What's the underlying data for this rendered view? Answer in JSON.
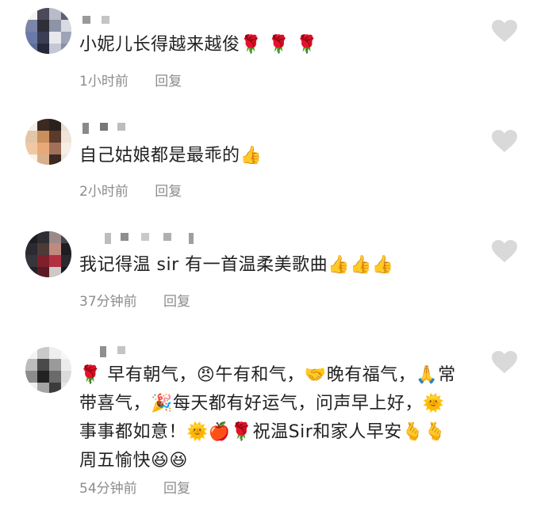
{
  "comments": [
    {
      "text": "小妮儿长得越来越俊🌹 🌹 🌹",
      "time": "1小时前",
      "reply": "回复"
    },
    {
      "text": "自己姑娘都是最乖的👍",
      "time": "2小时前",
      "reply": "回复"
    },
    {
      "text": "我记得温 sir 有一首温柔美歌曲👍👍👍",
      "time": "37分钟前",
      "reply": "回复"
    },
    {
      "text": "🌹 早有朝气，😠午有和气，🤝晚有福气，🙏常带喜气，🎉每天都有好运气，问声早上好，🌞事事都如意！🌞🍎🌹祝温Sir和家人早安🫰🫰周五愉快😆😆",
      "time": "54分钟前",
      "reply": "回复"
    }
  ],
  "icons": {
    "like": "heart-icon",
    "like_color": "#d9d9d9"
  }
}
